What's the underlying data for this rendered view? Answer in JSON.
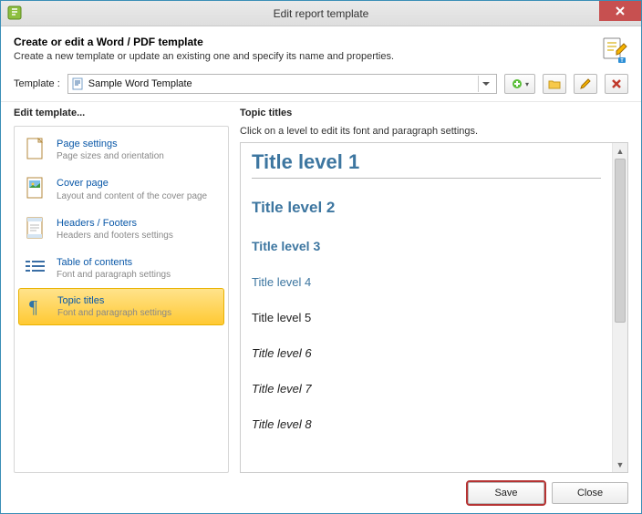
{
  "window": {
    "title": "Edit report template"
  },
  "header": {
    "heading": "Create or edit a Word / PDF template",
    "sub": "Create a new template or update an existing one and specify its name and properties."
  },
  "toolbar": {
    "template_label": "Template :",
    "selected_template": "Sample Word Template"
  },
  "left": {
    "title": "Edit template...",
    "items": [
      {
        "label": "Page settings",
        "sub": "Page sizes and orientation",
        "icon": "page-icon"
      },
      {
        "label": "Cover page",
        "sub": "Layout and content of the cover page",
        "icon": "cover-icon"
      },
      {
        "label": "Headers / Footers",
        "sub": "Headers and footers settings",
        "icon": "headerfooter-icon"
      },
      {
        "label": "Table of contents",
        "sub": "Font and paragraph settings",
        "icon": "toc-icon"
      },
      {
        "label": "Topic titles",
        "sub": "Font and paragraph settings",
        "icon": "pilcrow-icon",
        "selected": true
      }
    ]
  },
  "right": {
    "title": "Topic titles",
    "instruction": "Click on a level to edit its font and paragraph settings.",
    "levels": [
      "Title level 1",
      "Title level 2",
      "Title level 3",
      "Title level 4",
      "Title level 5",
      "Title level 6",
      "Title level 7",
      "Title level 8"
    ]
  },
  "footer": {
    "save": "Save",
    "close": "Close"
  }
}
